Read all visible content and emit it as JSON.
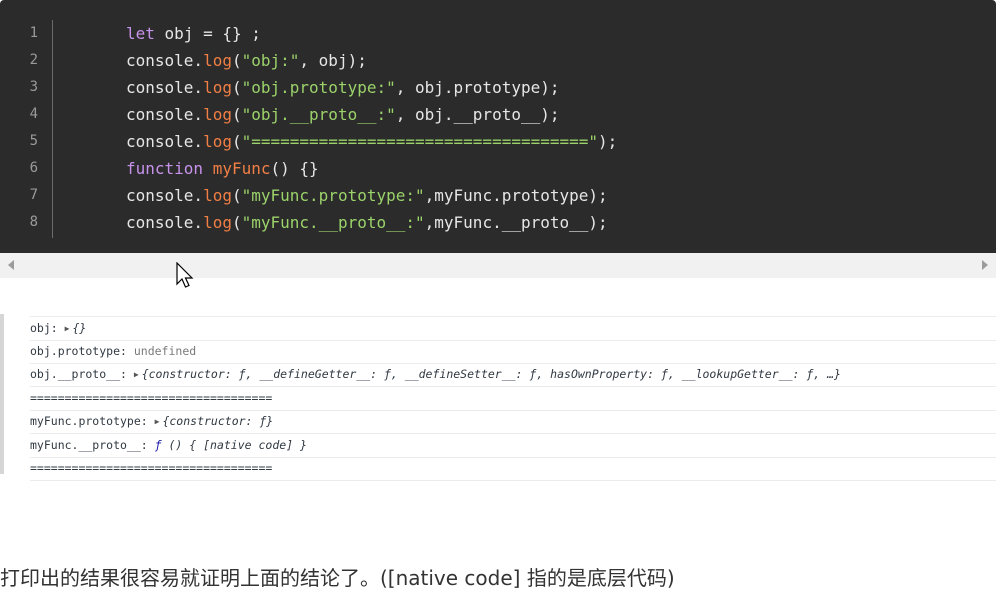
{
  "code": {
    "lines": [
      {
        "num": "1",
        "parts": [
          {
            "c": "kw",
            "t": "let"
          },
          {
            "c": "op",
            "t": " obj "
          },
          {
            "c": "op",
            "t": "= {} ;"
          }
        ]
      },
      {
        "num": "2",
        "parts": [
          {
            "c": "op",
            "t": "console."
          },
          {
            "c": "fn",
            "t": "log"
          },
          {
            "c": "op",
            "t": "("
          },
          {
            "c": "str",
            "t": "\"obj:\""
          },
          {
            "c": "op",
            "t": ", obj);"
          }
        ]
      },
      {
        "num": "3",
        "parts": [
          {
            "c": "op",
            "t": "console."
          },
          {
            "c": "fn",
            "t": "log"
          },
          {
            "c": "op",
            "t": "("
          },
          {
            "c": "str",
            "t": "\"obj.prototype:\""
          },
          {
            "c": "op",
            "t": ", obj.prototype);"
          }
        ]
      },
      {
        "num": "4",
        "parts": [
          {
            "c": "op",
            "t": "console."
          },
          {
            "c": "fn",
            "t": "log"
          },
          {
            "c": "op",
            "t": "("
          },
          {
            "c": "str",
            "t": "\"obj.__proto__:\""
          },
          {
            "c": "op",
            "t": ", obj.__proto__);"
          }
        ]
      },
      {
        "num": "5",
        "parts": [
          {
            "c": "op",
            "t": "console."
          },
          {
            "c": "fn",
            "t": "log"
          },
          {
            "c": "op",
            "t": "("
          },
          {
            "c": "str",
            "t": "\"===================================\""
          },
          {
            "c": "op",
            "t": ");"
          }
        ]
      },
      {
        "num": "6",
        "parts": [
          {
            "c": "kw",
            "t": "function"
          },
          {
            "c": "op",
            "t": " "
          },
          {
            "c": "fn",
            "t": "myFunc"
          },
          {
            "c": "op",
            "t": "() {}"
          }
        ]
      },
      {
        "num": "7",
        "parts": [
          {
            "c": "op",
            "t": "console."
          },
          {
            "c": "fn",
            "t": "log"
          },
          {
            "c": "op",
            "t": "("
          },
          {
            "c": "str",
            "t": "\"myFunc.prototype:\""
          },
          {
            "c": "op",
            "t": ",myFunc.prototype);"
          }
        ]
      },
      {
        "num": "8",
        "parts": [
          {
            "c": "op",
            "t": "console."
          },
          {
            "c": "fn",
            "t": "log"
          },
          {
            "c": "op",
            "t": "("
          },
          {
            "c": "str",
            "t": "\"myFunc.__proto__:\""
          },
          {
            "c": "op",
            "t": ",myFunc.__proto__);"
          }
        ]
      }
    ]
  },
  "console": {
    "rows": [
      {
        "key": "obj: ",
        "tri": "▶",
        "val": "{}",
        "style": "italic"
      },
      {
        "key": "obj.prototype: ",
        "tri": "",
        "val": "undefined",
        "style": "gray"
      },
      {
        "key": "obj.__proto__: ",
        "tri": "▶",
        "val": "{constructor: ƒ, __defineGetter__: ƒ, __defineSetter__: ƒ, hasOwnProperty: ƒ, __lookupGetter__: ƒ, …}",
        "style": "italic"
      },
      {
        "key": "===================================",
        "tri": "",
        "val": "",
        "style": "plain"
      },
      {
        "key": "myFunc.prototype: ",
        "tri": "▶",
        "val": "{constructor: ƒ}",
        "style": "italic"
      },
      {
        "key": "myFunc.__proto__: ",
        "tri": "",
        "val": "ƒ () { [native code] }",
        "style": "func"
      },
      {
        "key": "===================================",
        "tri": "",
        "val": "",
        "style": "plain"
      }
    ]
  },
  "caption": "打印出的结果很容易就证明上面的结论了。([native code] 指的是底层代码)",
  "colors": {
    "code_bg": "#2b2b2b",
    "keyword": "#c792ea",
    "function": "#f07f45",
    "string": "#9bd26a"
  }
}
